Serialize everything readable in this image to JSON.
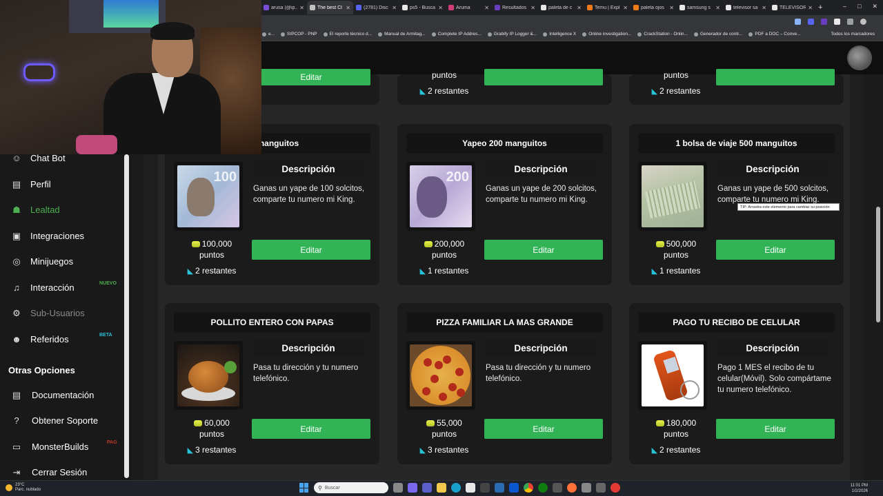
{
  "browser": {
    "tabs": [
      {
        "label": "arusa (@ip...",
        "color": "#7a4dd8"
      },
      {
        "label": "The best Cl",
        "color": "#c0c0c0",
        "active": true
      },
      {
        "label": "(2781) Disc",
        "color": "#5865f2"
      },
      {
        "label": "ps5 - Busca",
        "color": "#e8e8e8"
      },
      {
        "label": "Aruma",
        "color": "#d23c78"
      },
      {
        "label": "Resultados",
        "color": "#6a3dc0"
      },
      {
        "label": "paleta de c",
        "color": "#e8e8e8"
      },
      {
        "label": "Temu | Expl",
        "color": "#f07a1a"
      },
      {
        "label": "paleta ojos",
        "color": "#f07a1a"
      },
      {
        "label": "samsung s",
        "color": "#e8e8e8"
      },
      {
        "label": "televisor sa",
        "color": "#e8e8e8"
      },
      {
        "label": "TELEVISOR",
        "color": "#e8e8e8"
      }
    ],
    "new_tab": "+",
    "window_controls": [
      "–",
      "□",
      "✕"
    ],
    "bookmarks": [
      "e...",
      "SIPCOP - PNP",
      "El reporte técnico d...",
      "Manual de Armitag...",
      "Complete IP Addres...",
      "Grabify IP Logger &...",
      "Intelligence X",
      "Online investigation...",
      "CrackStation - Onlin...",
      "Generador de contr...",
      "PDF a DOC – Conve..."
    ],
    "bookmarks_all": "Todos los marcadores"
  },
  "sidebar": {
    "items": [
      {
        "label": "Chat Bot",
        "icon": "robot-icon",
        "glyph": "☺"
      },
      {
        "label": "Perfil",
        "icon": "id-card-icon",
        "glyph": "▤"
      },
      {
        "label": "Lealtad",
        "icon": "trophy-icon",
        "glyph": "☗",
        "active": true
      },
      {
        "label": "Integraciones",
        "icon": "chat-icon",
        "glyph": "▣"
      },
      {
        "label": "Minijuegos",
        "icon": "gamepad-icon",
        "glyph": "◎"
      },
      {
        "label": "Interacción",
        "icon": "music-icon",
        "glyph": "♫",
        "badge": "NUEVO",
        "badge_color": "#4caf50"
      },
      {
        "label": "Sub-Usuarios",
        "icon": "users-cog-icon",
        "glyph": "⚙",
        "disabled": true
      },
      {
        "label": "Referidos",
        "icon": "users-icon",
        "glyph": "☻",
        "badge": "BETA",
        "badge_color": "#28c3d8"
      }
    ],
    "section_title": "Otras Opciones",
    "other_items": [
      {
        "label": "Documentación",
        "icon": "book-icon",
        "glyph": "▤"
      },
      {
        "label": "Obtener Soporte",
        "icon": "help-icon",
        "glyph": "?"
      },
      {
        "label": "MonsterBuilds",
        "icon": "laptop-icon",
        "glyph": "▭",
        "badge": "PAG",
        "badge_color": "#c0392b"
      },
      {
        "label": "Cerrar Sesión",
        "icon": "logout-icon",
        "glyph": "⇥"
      }
    ]
  },
  "rewards_partial": [
    {
      "button": "Editar"
    },
    {
      "points_unit": "puntos",
      "remaining": "2 restantes",
      "button": ""
    },
    {
      "points_unit": "puntos",
      "remaining": "2 restantes",
      "button": ""
    }
  ],
  "rewards": [
    {
      "title": "00 manguitos",
      "desc_title": "Descripción",
      "desc": "Ganas un yape de 100 solcitos, comparte tu numero mi King.",
      "points": "100,000",
      "points_unit": "puntos",
      "remaining": "2 restantes",
      "button": "Editar",
      "image": "banknote-100-image"
    },
    {
      "title": "Yapeo 200 manguitos",
      "desc_title": "Descripción",
      "desc": "Ganas un yape de 200 solcitos, comparte tu numero mi King.",
      "points": "200,000",
      "points_unit": "puntos",
      "remaining": "1 restantes",
      "button": "Editar",
      "image": "banknote-200-image"
    },
    {
      "title": "1 bolsa de viaje 500 manguitos",
      "desc_title": "Descripción",
      "desc": "Ganas un yape de 500 solcitos, comparte tu numero mi King.",
      "points": "500,000",
      "points_unit": "puntos",
      "remaining": "1 restantes",
      "button": "Editar",
      "image": "money-stack-image"
    },
    {
      "title": "POLLITO ENTERO CON PAPAS",
      "desc_title": "Descripción",
      "desc": "Pasa tu dirección y tu numero telefónico.",
      "points": "60,000",
      "points_unit": "puntos",
      "remaining": "3 restantes",
      "button": "Editar",
      "image": "roast-chicken-image"
    },
    {
      "title": "PIZZA FAMILIAR LA MAS GRANDE",
      "desc_title": "Descripción",
      "desc": "Pasa tu dirección y tu numero telefónico.",
      "points": "55,000",
      "points_unit": "puntos",
      "remaining": "3 restantes",
      "button": "Editar",
      "image": "pizza-image"
    },
    {
      "title": "PAGO TU RECIBO DE CELULAR",
      "desc_title": "Descripción",
      "desc": "Pago 1 MES el recibo de tu celular(Móvil). Solo compártame tu numero telefónico.",
      "points": "180,000",
      "points_unit": "puntos",
      "remaining": "2 restantes",
      "button": "Editar",
      "image": "cellphone-image"
    }
  ],
  "tooltip": "TIP: Arrastra este elemento para cambiar su posición",
  "taskbar": {
    "weather_temp": "23°C",
    "weather_desc": "Parc. nublado",
    "search_placeholder": "Buscar",
    "time": "11:01 PM",
    "date": "1/2/2026"
  },
  "colors": {
    "accent": "#32b456",
    "active_nav": "#4caf50",
    "cart": "#28c3d8"
  }
}
